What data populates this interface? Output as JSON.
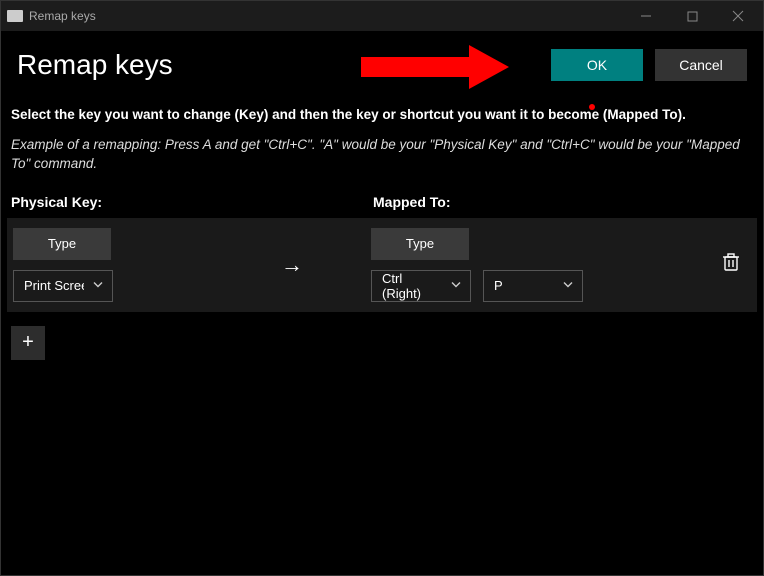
{
  "window": {
    "title": "Remap keys"
  },
  "header": {
    "page_title": "Remap keys",
    "ok_label": "OK",
    "cancel_label": "Cancel"
  },
  "instructions": {
    "main": "Select the key you want to change (Key) and then the key or shortcut you want it to become (Mapped To).",
    "example": "Example of a remapping: Press A and get \"Ctrl+C\". \"A\" would be your \"Physical Key\" and \"Ctrl+C\" would be your \"Mapped To\" command."
  },
  "columns": {
    "physical_label": "Physical Key:",
    "mapped_label": "Mapped To:"
  },
  "row": {
    "type_label": "Type",
    "physical_value": "Print Scree",
    "mapped_type_label": "Type",
    "mapped_modifier": "Ctrl (Right)",
    "mapped_key": "P"
  },
  "icons": {
    "arrow": "→",
    "plus": "+"
  }
}
